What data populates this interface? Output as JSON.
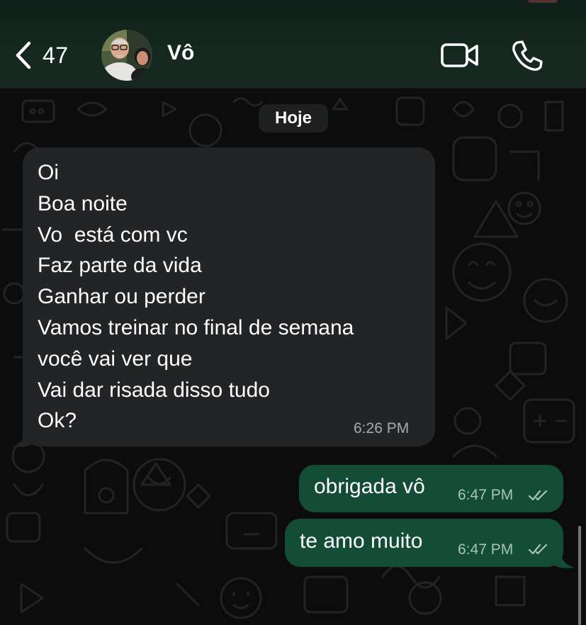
{
  "header": {
    "back_count": "47",
    "contact_name": "Vô"
  },
  "chat": {
    "date_label": "Hoje",
    "messages": [
      {
        "direction": "incoming",
        "lines": [
          "Oi",
          "Boa noite",
          "Vo  está com vc",
          "Faz parte da vida",
          "Ganhar ou perder",
          "Vamos treinar no final de semana",
          "você vai ver que",
          "Vai dar risada disso tudo",
          "Ok?"
        ],
        "time": "6:26 PM"
      },
      {
        "direction": "outgoing",
        "text": "obrigada vô",
        "time": "6:47 PM",
        "status": "read"
      },
      {
        "direction": "outgoing",
        "text": "te amo muito",
        "time": "6:47 PM",
        "status": "read"
      }
    ]
  },
  "icons": {
    "back": "chevron-left-icon",
    "video": "video-camera-icon",
    "call": "phone-icon",
    "read_receipt": "double-check-icon"
  },
  "colors": {
    "header_bg": "#15281f",
    "incoming_bubble": "#232426",
    "outgoing_bubble": "#134d37",
    "background": "#0c0c0c",
    "timestamp_incoming": "#a8a9aa",
    "timestamp_outgoing": "#a9c3b7"
  }
}
